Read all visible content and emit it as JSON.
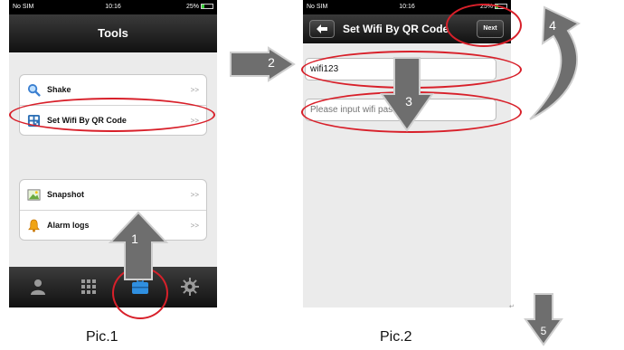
{
  "phone1": {
    "status": {
      "carrier": "No SIM",
      "time": "10:16",
      "battery": "25%"
    },
    "title": "Tools",
    "group1": [
      {
        "label": "Shake",
        "icon": "search-icon",
        "chevron": ">>"
      },
      {
        "label": "Set Wifi By QR Code",
        "icon": "qr-code-icon",
        "chevron": ">>"
      }
    ],
    "group2": [
      {
        "label": "Snapshot",
        "icon": "image-icon",
        "chevron": ">>"
      },
      {
        "label": "Alarm logs",
        "icon": "bell-icon",
        "chevron": ">>"
      }
    ],
    "tabs": [
      "person-icon",
      "grid-icon",
      "toolbox-icon",
      "gear-icon"
    ],
    "active_tab": "toolbox-icon"
  },
  "phone2": {
    "status": {
      "carrier": "No SIM",
      "time": "10:16",
      "battery": "25%"
    },
    "back_icon": "back-arrow-icon",
    "title": "Set Wifi By QR Code",
    "next_label": "Next",
    "ssid_value": "wifi123",
    "password_placeholder": "Please input wifi password"
  },
  "steps": [
    "1",
    "2",
    "3",
    "4",
    "5"
  ],
  "captions": {
    "pic1": "Pic.1",
    "pic2": "Pic.2"
  },
  "colors": {
    "highlight": "#d8202a",
    "arrow": "#6e6e6e",
    "tab_active": "#2f8fe0"
  }
}
